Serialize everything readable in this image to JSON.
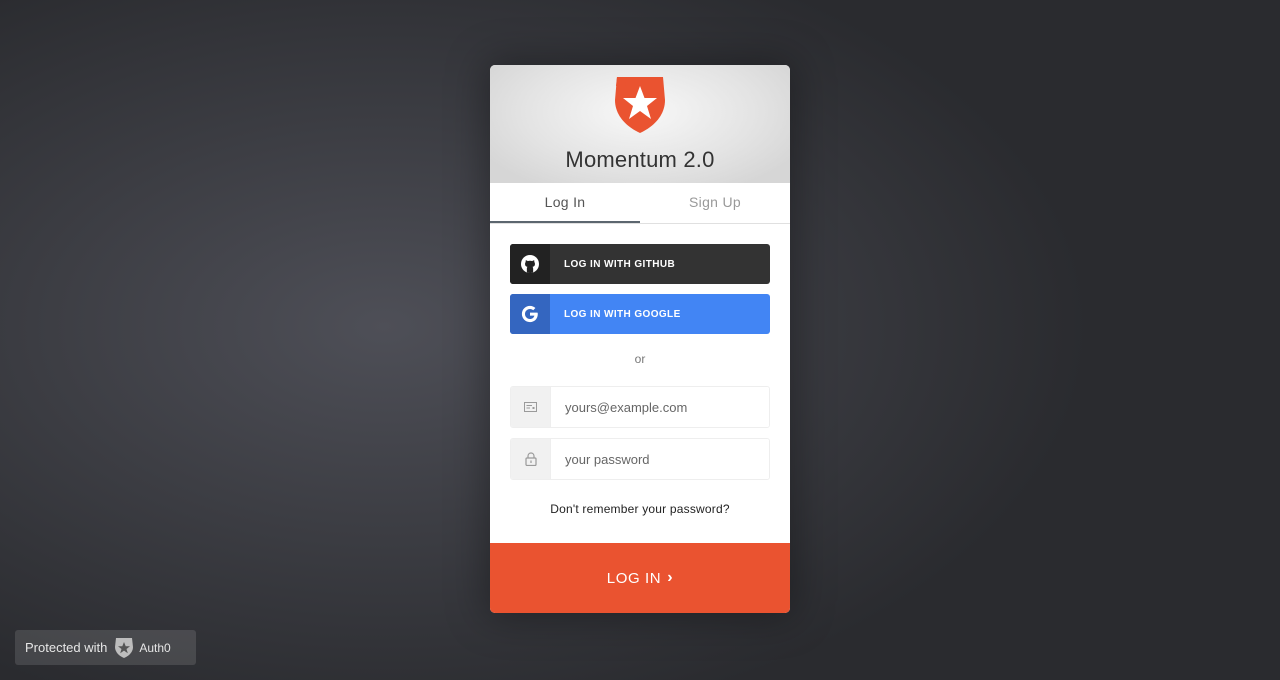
{
  "header": {
    "title": "Momentum 2.0",
    "logo_icon": "auth0-shield-star-icon",
    "logo_color": "#ea5330"
  },
  "tabs": [
    {
      "label": "Log In",
      "active": true
    },
    {
      "label": "Sign Up",
      "active": false
    }
  ],
  "social": {
    "github_label": "LOG IN WITH GITHUB",
    "github_icon": "github-icon",
    "google_label": "LOG IN WITH GOOGLE",
    "google_icon": "google-icon",
    "github_color": "#333333",
    "google_color": "#4285f4"
  },
  "separator": "or",
  "form": {
    "email_placeholder": "yours@example.com",
    "email_icon": "envelope-icon",
    "password_placeholder": "your password",
    "password_icon": "lock-icon",
    "forgot_label": "Don't remember your password?"
  },
  "submit": {
    "label": "LOG IN",
    "chevron": "›",
    "color": "#ea5330"
  },
  "badge": {
    "prefix": "Protected with",
    "brand": "Auth0",
    "icon": "auth0-logo-icon"
  }
}
